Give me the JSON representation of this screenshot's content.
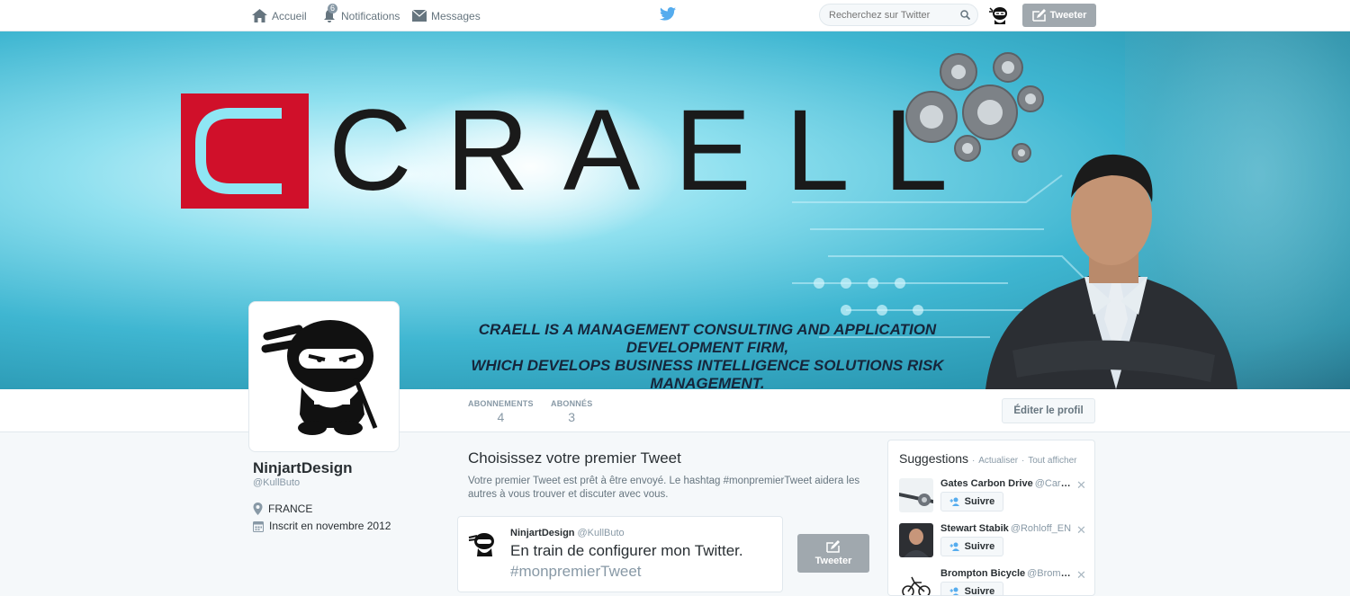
{
  "topbar": {
    "home_label": "Accueil",
    "notifications_label": "Notifications",
    "notifications_count": "6",
    "messages_label": "Messages",
    "search_placeholder": "Recherchez sur Twitter",
    "tweet_label": "Tweeter"
  },
  "banner": {
    "logo_text": "CRAELL",
    "tagline_line1": "CRAELL IS A MANAGEMENT CONSULTING AND APPLICATION DEVELOPMENT FIRM,",
    "tagline_line2": "WHICH DEVELOPS BUSINESS INTELLIGENCE SOLUTIONS RISK MANAGEMENT."
  },
  "stats": {
    "following_label": "ABONNEMENTS",
    "following_value": "4",
    "followers_label": "ABONNÉS",
    "followers_value": "3"
  },
  "edit_profile_label": "Éditer le profil",
  "profile": {
    "name": "NinjartDesign",
    "handle": "@KullButo",
    "location": "FRANCE",
    "joined": "Inscrit en novembre 2012"
  },
  "main": {
    "title": "Choisissez votre premier Tweet",
    "description": "Votre premier Tweet est prêt à être envoyé. Le hashtag #monpremierTweet aidera les autres à vous trouver et discuter avec vous.",
    "composer_name": "NinjartDesign",
    "composer_handle": "@KullButo",
    "composer_text": "En train de configurer mon Twitter.",
    "composer_hashtag": "#monpremierTweet",
    "tweet_button": "Tweeter"
  },
  "suggestions": {
    "title": "Suggestions",
    "refresh": "Actualiser",
    "view_all": "Tout afficher",
    "separator": "·",
    "follow_label": "Suivre",
    "items": [
      {
        "name": "Gates Carbon Drive",
        "handle": "@Carbo..."
      },
      {
        "name": "Stewart Stabik",
        "handle": "@Rohloff_EN"
      },
      {
        "name": "Brompton Bicycle",
        "handle": "@Bromp..."
      }
    ]
  },
  "colors": {
    "twitter_blue": "#55acee",
    "logo_red": "#d0102a",
    "button_gray": "#a0a8ae"
  }
}
